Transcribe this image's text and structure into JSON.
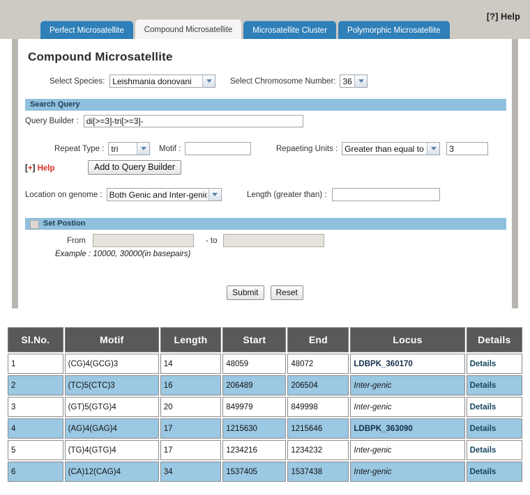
{
  "header": {
    "help_label": "[?] Help",
    "tabs": [
      {
        "label": "Perfect Microsatellite",
        "active": false
      },
      {
        "label": "Compound Microsatellite",
        "active": true
      },
      {
        "label": "Microsatellite Cluster",
        "active": false
      },
      {
        "label": "Polymorphic Microsatellite",
        "active": false
      }
    ]
  },
  "form": {
    "title": "Compound Microsatellite",
    "species_label": "Select Species:",
    "species_value": "Leishmania donovani",
    "chromosome_label": "Select Chromosome Number:",
    "chromosome_value": "36",
    "search_query_bar": "Search Query",
    "query_builder_label": "Query Builder :",
    "query_builder_value": "di[>=3]-tri[>=3]-",
    "repeat_type_label": "Repeat Type :",
    "repeat_type_value": "tri",
    "motif_label": "Motif :",
    "motif_value": "",
    "repeating_units_label": "Repaeting Units :",
    "repeating_units_value": "Greater than equal to",
    "repeating_units_number": "3",
    "help_plus_bracket_open": "[",
    "help_plus_sign": "+",
    "help_plus_bracket_close": "]",
    "help_plus_label": "Help",
    "add_to_query_label": "Add to Query Builder",
    "location_label": "Location on genome :",
    "location_value": "Both Genic and Inter-genic",
    "length_label": "Length (greater than) :",
    "length_value": "",
    "set_position_bar": "Set Postion",
    "from_label": "From",
    "from_value": "",
    "to_label": "- to",
    "to_value": "",
    "example_text": "Example : 10000, 30000(in basepairs)",
    "submit_label": "Submit",
    "reset_label": "Reset"
  },
  "results": {
    "columns": [
      "Sl.No.",
      "Motif",
      "Length",
      "Start",
      "End",
      "Locus",
      "Details"
    ],
    "rows": [
      {
        "sl": "1",
        "motif": "(CG)4(GCG)3",
        "length": "14",
        "start": "48059",
        "end": "48072",
        "locus": "LDBPK_360170",
        "locus_type": "gene",
        "details": "Details"
      },
      {
        "sl": "2",
        "motif": "(TC)5(CTC)3",
        "length": "16",
        "start": "206489",
        "end": "206504",
        "locus": "Inter-genic",
        "locus_type": "inter",
        "details": "Details"
      },
      {
        "sl": "3",
        "motif": "(GT)5(GTG)4",
        "length": "20",
        "start": "849979",
        "end": "849998",
        "locus": "Inter-genic",
        "locus_type": "inter",
        "details": "Details"
      },
      {
        "sl": "4",
        "motif": "(AG)4(GAG)4",
        "length": "17",
        "start": "1215630",
        "end": "1215646",
        "locus": "LDBPK_363090",
        "locus_type": "gene",
        "details": "Details"
      },
      {
        "sl": "5",
        "motif": "(TG)4(GTG)4",
        "length": "17",
        "start": "1234216",
        "end": "1234232",
        "locus": "Inter-genic",
        "locus_type": "inter",
        "details": "Details"
      },
      {
        "sl": "6",
        "motif": "(CA)12(CAG)4",
        "length": "34",
        "start": "1537405",
        "end": "1537438",
        "locus": "Inter-genic",
        "locus_type": "inter",
        "details": "Details"
      }
    ]
  },
  "colors": {
    "tab_blue": "#2f7fb8",
    "section_bar_blue": "#8fc0de",
    "table_header_gray": "#595959",
    "row_highlight_blue": "#9bc8e3",
    "page_band_gray": "#cdc9c3",
    "help_red": "#d93025"
  }
}
